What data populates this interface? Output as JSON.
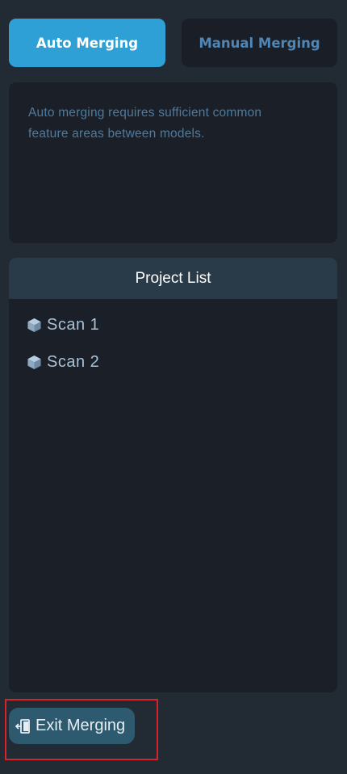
{
  "tabs": {
    "auto_label": "Auto Merging",
    "manual_label": "Manual Merging",
    "active": "auto"
  },
  "description": {
    "line1": "Auto merging requires sufficient common",
    "line2": "feature areas between models."
  },
  "project_list": {
    "title": "Project List",
    "items": [
      {
        "label": "Scan  1",
        "icon": "cube-icon"
      },
      {
        "label": "Scan  2",
        "icon": "cube-icon"
      }
    ]
  },
  "exit": {
    "label": "Exit Merging",
    "icon": "exit-icon"
  },
  "colors": {
    "background": "#222a33",
    "accent": "#2ea0d6",
    "panel": "#1b2028",
    "header": "#293a48",
    "exit_button": "#2e5a70",
    "highlight": "#d9232a"
  }
}
